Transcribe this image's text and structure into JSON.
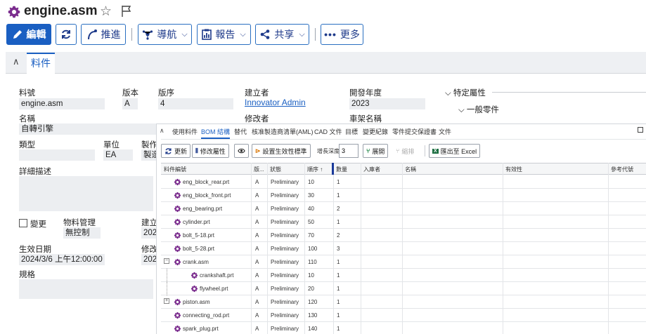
{
  "title": "engine.asm",
  "toolbar": {
    "edit": "編輯",
    "promote": "推進",
    "navigate": "導航",
    "reports": "報告",
    "share": "共享",
    "more": "更多"
  },
  "tabs": {
    "item": "料件"
  },
  "form": {
    "part_number_label": "料號",
    "part_number_value": "engine.asm",
    "revision_label": "版本",
    "revision_value": "A",
    "sequence_label": "版序",
    "sequence_value": "4",
    "creator_label": "建立者",
    "creator_value": "Innovator Admin",
    "dev_year_label": "開發年度",
    "dev_year_value": "2023",
    "modifier_label": "修改者",
    "vehicle_name_label": "車架名稱",
    "name_label": "名稱",
    "name_value": "自轉引擎",
    "type_label": "類型",
    "unit_label": "單位",
    "unit_value": "EA",
    "make_label": "製作",
    "make_value": "製造",
    "description_label": "詳細描述",
    "change_label": "變更",
    "material_mgmt_label": "物料管理",
    "material_mgmt_value": "無控制",
    "created_on_label": "建立",
    "created_on_value": "202",
    "effective_date_label": "生效日期",
    "effective_date_value": "2024/3/6 上午12:00:00",
    "modified_on_label": "修改",
    "modified_on_value": "202",
    "spec_label": "規格",
    "specific_props": "特定屬性",
    "general_part": "一般零件"
  },
  "panel_tabs": [
    "使用料件",
    "BOM 結構",
    "替代",
    "核准製造商清單(AML)",
    "CAD 文件",
    "目標",
    "變更紀錄",
    "零件提交保證書",
    "文件"
  ],
  "panel_toolbar": {
    "refresh": "更新",
    "edit_props": "修改屬性",
    "set_effectivity": "設置生效性標準",
    "depth_label": "增長深度",
    "depth_value": "3",
    "expand": "展開",
    "collapse": "縮排",
    "export": "匯出至 Excel"
  },
  "grid": {
    "headers": [
      "料件編號",
      "版...",
      "狀態",
      "順序 ↑",
      "數量",
      "入庫者",
      "名稱",
      "有效性",
      "參考代號"
    ],
    "rows": [
      {
        "part": "eng_block_rear.prt",
        "rev": "A",
        "state": "Preliminary",
        "seq": "10",
        "qty": "1",
        "level": 1,
        "tree": ""
      },
      {
        "part": "eng_block_front.prt",
        "rev": "A",
        "state": "Preliminary",
        "seq": "30",
        "qty": "1",
        "level": 1,
        "tree": ""
      },
      {
        "part": "eng_bearing.prt",
        "rev": "A",
        "state": "Preliminary",
        "seq": "40",
        "qty": "2",
        "level": 1,
        "tree": ""
      },
      {
        "part": "cylinder.prt",
        "rev": "A",
        "state": "Preliminary",
        "seq": "50",
        "qty": "1",
        "level": 1,
        "tree": ""
      },
      {
        "part": "bolt_5-18.prt",
        "rev": "A",
        "state": "Preliminary",
        "seq": "70",
        "qty": "2",
        "level": 1,
        "tree": ""
      },
      {
        "part": "bolt_5-28.prt",
        "rev": "A",
        "state": "Preliminary",
        "seq": "100",
        "qty": "3",
        "level": 1,
        "tree": ""
      },
      {
        "part": "crank.asm",
        "rev": "A",
        "state": "Preliminary",
        "seq": "110",
        "qty": "1",
        "level": 1,
        "tree": "−"
      },
      {
        "part": "crankshaft.prt",
        "rev": "A",
        "state": "Preliminary",
        "seq": "10",
        "qty": "1",
        "level": 2,
        "tree": ""
      },
      {
        "part": "flywheel.prt",
        "rev": "A",
        "state": "Preliminary",
        "seq": "20",
        "qty": "1",
        "level": 2,
        "tree": ""
      },
      {
        "part": "piston.asm",
        "rev": "A",
        "state": "Preliminary",
        "seq": "120",
        "qty": "1",
        "level": 1,
        "tree": "+"
      },
      {
        "part": "connecting_rod.prt",
        "rev": "A",
        "state": "Preliminary",
        "seq": "130",
        "qty": "1",
        "level": 1,
        "tree": ""
      },
      {
        "part": "spark_plug.prt",
        "rev": "A",
        "state": "Preliminary",
        "seq": "140",
        "qty": "1",
        "level": 1,
        "tree": ""
      }
    ]
  },
  "colors": {
    "accent": "#1a5fc2",
    "gear": "#7b2d8e"
  }
}
